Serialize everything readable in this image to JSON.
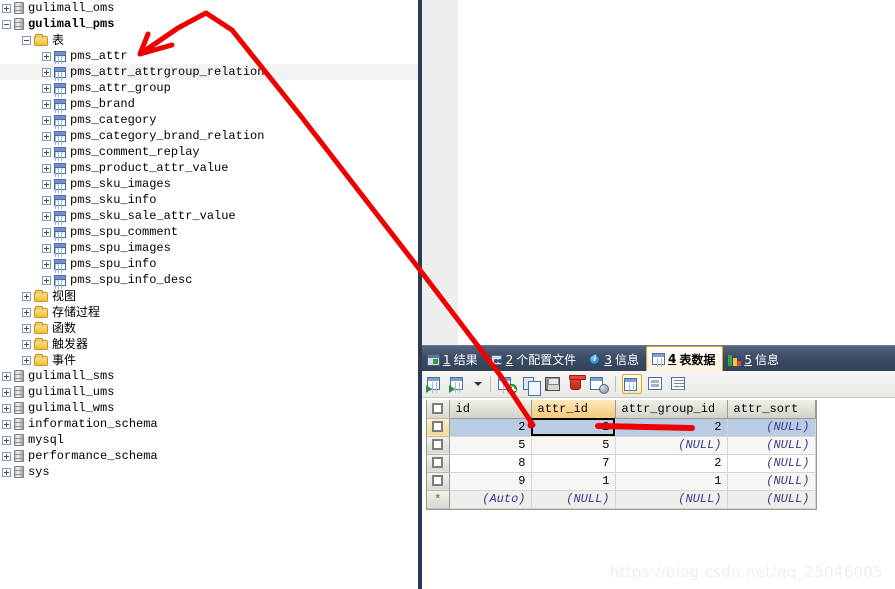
{
  "tree": {
    "nodes": [
      {
        "indent": 0,
        "expander": "plus",
        "icon": "database-icon",
        "label": "gulimall_oms",
        "bold": false,
        "cjk": false,
        "hover": false
      },
      {
        "indent": 0,
        "expander": "minus",
        "icon": "database-icon",
        "label": "gulimall_pms",
        "bold": true,
        "cjk": false,
        "hover": false
      },
      {
        "indent": 1,
        "expander": "minus",
        "icon": "folder-icon",
        "label": "表",
        "bold": false,
        "cjk": true,
        "hover": false
      },
      {
        "indent": 2,
        "expander": "plus",
        "icon": "table-icon",
        "label": "pms_attr",
        "bold": false,
        "cjk": false,
        "hover": false
      },
      {
        "indent": 2,
        "expander": "plus",
        "icon": "table-icon",
        "label": "pms_attr_attrgroup_relation",
        "bold": false,
        "cjk": false,
        "hover": true
      },
      {
        "indent": 2,
        "expander": "plus",
        "icon": "table-icon",
        "label": "pms_attr_group",
        "bold": false,
        "cjk": false,
        "hover": false
      },
      {
        "indent": 2,
        "expander": "plus",
        "icon": "table-icon",
        "label": "pms_brand",
        "bold": false,
        "cjk": false,
        "hover": false
      },
      {
        "indent": 2,
        "expander": "plus",
        "icon": "table-icon",
        "label": "pms_category",
        "bold": false,
        "cjk": false,
        "hover": false
      },
      {
        "indent": 2,
        "expander": "plus",
        "icon": "table-icon",
        "label": "pms_category_brand_relation",
        "bold": false,
        "cjk": false,
        "hover": false
      },
      {
        "indent": 2,
        "expander": "plus",
        "icon": "table-icon",
        "label": "pms_comment_replay",
        "bold": false,
        "cjk": false,
        "hover": false
      },
      {
        "indent": 2,
        "expander": "plus",
        "icon": "table-icon",
        "label": "pms_product_attr_value",
        "bold": false,
        "cjk": false,
        "hover": false
      },
      {
        "indent": 2,
        "expander": "plus",
        "icon": "table-icon",
        "label": "pms_sku_images",
        "bold": false,
        "cjk": false,
        "hover": false
      },
      {
        "indent": 2,
        "expander": "plus",
        "icon": "table-icon",
        "label": "pms_sku_info",
        "bold": false,
        "cjk": false,
        "hover": false
      },
      {
        "indent": 2,
        "expander": "plus",
        "icon": "table-icon",
        "label": "pms_sku_sale_attr_value",
        "bold": false,
        "cjk": false,
        "hover": false
      },
      {
        "indent": 2,
        "expander": "plus",
        "icon": "table-icon",
        "label": "pms_spu_comment",
        "bold": false,
        "cjk": false,
        "hover": false
      },
      {
        "indent": 2,
        "expander": "plus",
        "icon": "table-icon",
        "label": "pms_spu_images",
        "bold": false,
        "cjk": false,
        "hover": false
      },
      {
        "indent": 2,
        "expander": "plus",
        "icon": "table-icon",
        "label": "pms_spu_info",
        "bold": false,
        "cjk": false,
        "hover": false
      },
      {
        "indent": 2,
        "expander": "plus",
        "icon": "table-icon",
        "label": "pms_spu_info_desc",
        "bold": false,
        "cjk": false,
        "hover": false
      },
      {
        "indent": 1,
        "expander": "plus",
        "icon": "folder-icon",
        "label": "视图",
        "bold": false,
        "cjk": true,
        "hover": false
      },
      {
        "indent": 1,
        "expander": "plus",
        "icon": "folder-icon",
        "label": "存储过程",
        "bold": false,
        "cjk": true,
        "hover": false
      },
      {
        "indent": 1,
        "expander": "plus",
        "icon": "folder-icon",
        "label": "函数",
        "bold": false,
        "cjk": true,
        "hover": false
      },
      {
        "indent": 1,
        "expander": "plus",
        "icon": "folder-icon",
        "label": "触发器",
        "bold": false,
        "cjk": true,
        "hover": false
      },
      {
        "indent": 1,
        "expander": "plus",
        "icon": "folder-icon",
        "label": "事件",
        "bold": false,
        "cjk": true,
        "hover": false
      },
      {
        "indent": 0,
        "expander": "plus",
        "icon": "database-icon",
        "label": "gulimall_sms",
        "bold": false,
        "cjk": false,
        "hover": false
      },
      {
        "indent": 0,
        "expander": "plus",
        "icon": "database-icon",
        "label": "gulimall_ums",
        "bold": false,
        "cjk": false,
        "hover": false
      },
      {
        "indent": 0,
        "expander": "plus",
        "icon": "database-icon",
        "label": "gulimall_wms",
        "bold": false,
        "cjk": false,
        "hover": false
      },
      {
        "indent": 0,
        "expander": "plus",
        "icon": "database-icon",
        "label": "information_schema",
        "bold": false,
        "cjk": false,
        "hover": false
      },
      {
        "indent": 0,
        "expander": "plus",
        "icon": "database-icon",
        "label": "mysql",
        "bold": false,
        "cjk": false,
        "hover": false
      },
      {
        "indent": 0,
        "expander": "plus",
        "icon": "database-icon",
        "label": "performance_schema",
        "bold": false,
        "cjk": false,
        "hover": false
      },
      {
        "indent": 0,
        "expander": "plus",
        "icon": "database-icon",
        "label": "sys",
        "bold": false,
        "cjk": false,
        "hover": false
      }
    ]
  },
  "result_tabs": [
    {
      "num": "1",
      "label": "结果",
      "icon": "result-set-icon",
      "active": false
    },
    {
      "num": "2",
      "label": "个配置文件",
      "icon": "profile-icon",
      "active": false
    },
    {
      "num": "3",
      "label": "信息",
      "icon": "info-icon",
      "active": false
    },
    {
      "num": "4",
      "label": "表数据",
      "icon": "table-grid-icon",
      "active": true
    },
    {
      "num": "5",
      "label": "信息",
      "icon": "chart-icon",
      "active": false
    }
  ],
  "grid_toolbar": {
    "buttons": [
      {
        "name": "apply-changes-button",
        "icon": "grid-apply-icon",
        "selected": false
      },
      {
        "name": "refresh-options-button",
        "icon": "grid-refresh-icon",
        "selected": false
      },
      {
        "name": "insert-record-button",
        "icon": "add-record-icon",
        "selected": false
      },
      {
        "name": "duplicate-record-button",
        "icon": "copy-record-icon",
        "selected": false
      },
      {
        "name": "save-record-button",
        "icon": "save-icon",
        "selected": false
      },
      {
        "name": "delete-record-button",
        "icon": "trash-icon",
        "selected": false
      },
      {
        "name": "discard-changes-button",
        "icon": "cancel-icon",
        "selected": false
      },
      {
        "name": "grid-view-button",
        "icon": "grid-view-icon",
        "selected": true
      },
      {
        "name": "form-view-button",
        "icon": "form-view-icon",
        "selected": false
      },
      {
        "name": "text-view-button",
        "icon": "text-view-icon",
        "selected": false
      }
    ]
  },
  "data_table": {
    "columns": [
      {
        "name": "id",
        "sorted": false
      },
      {
        "name": "attr_id",
        "sorted": true
      },
      {
        "name": "attr_group_id",
        "sorted": false
      },
      {
        "name": "attr_sort",
        "sorted": false
      }
    ],
    "null_text": "(NULL)",
    "auto_text": "(Auto)",
    "new_row_marker": "*",
    "rows": [
      {
        "id": "2",
        "attr_id": "2",
        "attr_group_id": "2",
        "attr_sort": "(NULL)",
        "selected": true,
        "focus_col": 1
      },
      {
        "id": "5",
        "attr_id": "5",
        "attr_group_id": "(NULL)",
        "attr_sort": "(NULL)",
        "selected": false,
        "focus_col": -1
      },
      {
        "id": "8",
        "attr_id": "7",
        "attr_group_id": "2",
        "attr_sort": "(NULL)",
        "selected": false,
        "focus_col": -1
      },
      {
        "id": "9",
        "attr_id": "1",
        "attr_group_id": "1",
        "attr_sort": "(NULL)",
        "selected": false,
        "focus_col": -1
      },
      {
        "id": "(Auto)",
        "attr_id": "(NULL)",
        "attr_group_id": "(NULL)",
        "attr_sort": "(NULL)",
        "selected": false,
        "focus_col": -1,
        "is_new": true
      }
    ]
  },
  "annotations": {
    "color": "#ee0000",
    "arrow_target": "pms_attr_attrgroup_relation",
    "underline_target": "attr_group_id"
  },
  "watermark": {
    "text": "https://blog.csdn.net/qq_25046005"
  }
}
